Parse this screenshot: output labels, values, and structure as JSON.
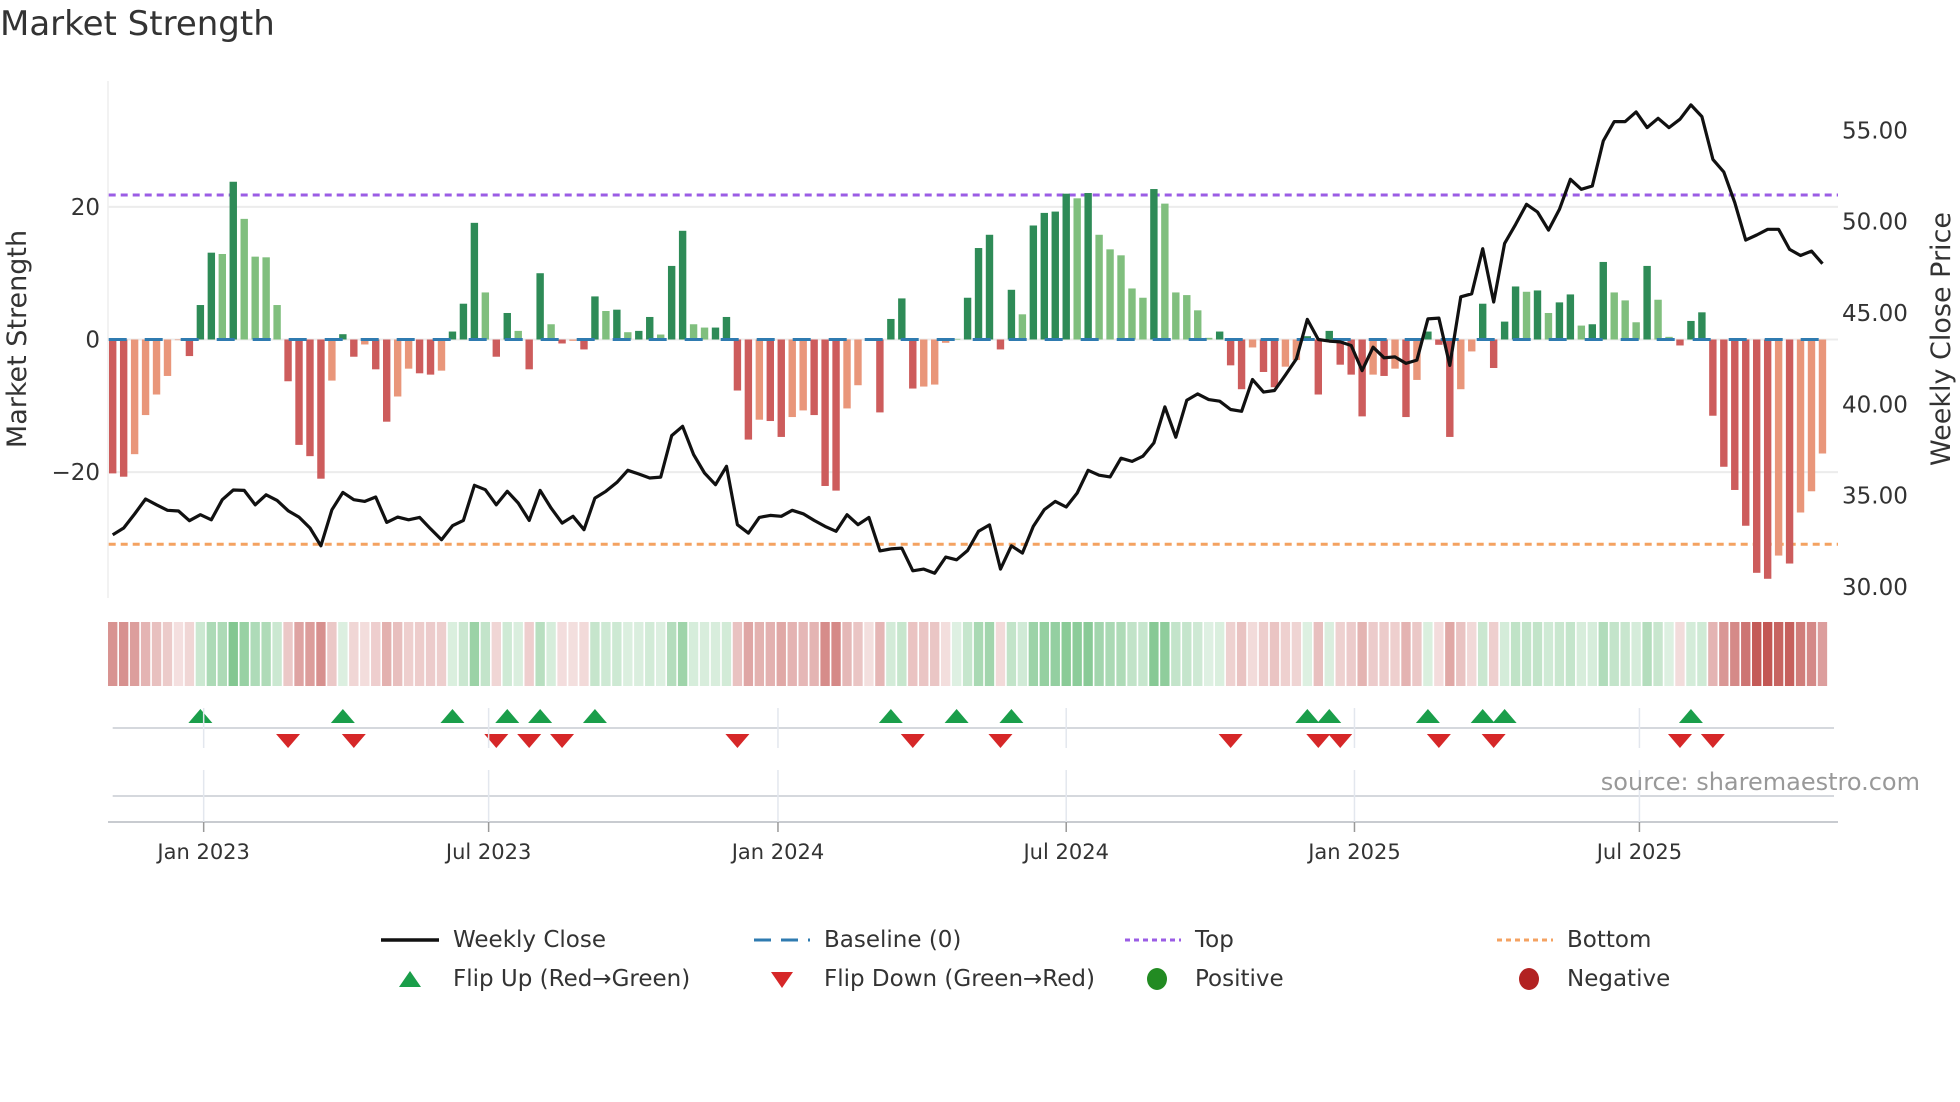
{
  "title": "Market Strength",
  "source": "source: sharemaestro.com",
  "legend": {
    "weekly_close": "Weekly Close",
    "baseline": "Baseline (0)",
    "top": "Top",
    "bottom": "Bottom",
    "flip_up": "Flip Up (Red→Green)",
    "flip_down": "Flip Down (Green→Red)",
    "positive": "Positive",
    "negative": "Negative"
  },
  "colors": {
    "pos_strong": "#2e8b57",
    "pos_weak": "#80bf7e",
    "neg_strong": "#cd5c5c",
    "neg_weak": "#e9967a",
    "baseline": "#2f7bb0",
    "top": "#9b5de5",
    "bottom": "#f4a261",
    "close": "#111111",
    "flip_up": "#1a9e4a",
    "flip_down": "#d62728",
    "positive": "#228b22",
    "negative": "#b22222",
    "strip_pos": "#4caf61",
    "strip_neg": "#c0504d"
  },
  "chart_data": {
    "type": "bar",
    "title": "Market Strength",
    "ylabel": "Market Strength",
    "y2label": "Weekly Close Price",
    "ylim": [
      -39,
      39
    ],
    "y2lim": [
      29.4,
      57.7
    ],
    "yticks": [
      {
        "value": 20,
        "label": "20"
      },
      {
        "value": 0,
        "label": "0"
      },
      {
        "value": -20,
        "label": "−20"
      }
    ],
    "y2ticks": [
      {
        "value": 55,
        "label": "55.00"
      },
      {
        "value": 50,
        "label": "50.00"
      },
      {
        "value": 45,
        "label": "45.00"
      },
      {
        "value": 40,
        "label": "40.00"
      },
      {
        "value": 35,
        "label": "35.00"
      },
      {
        "value": 30,
        "label": "30.00"
      }
    ],
    "xticks": [
      {
        "week": 8.3,
        "label": "Jan 2023"
      },
      {
        "week": 34.3,
        "label": "Jul 2023"
      },
      {
        "week": 60.7,
        "label": "Jan 2024"
      },
      {
        "week": 87.0,
        "label": "Jul 2024"
      },
      {
        "week": 113.3,
        "label": "Jan 2025"
      },
      {
        "week": 139.3,
        "label": "Jul 2025"
      }
    ],
    "top_level": 21.8,
    "bottom_level": -30.9,
    "strength": [
      -20.2,
      -20.7,
      -17.3,
      -11.4,
      -8.3,
      -5.5,
      -0.1,
      -2.5,
      5.2,
      13.1,
      12.9,
      23.8,
      18.2,
      12.5,
      12.4,
      5.2,
      -6.3,
      -15.9,
      -17.6,
      -21.0,
      -6.2,
      0.8,
      -2.6,
      -0.75,
      -4.5,
      -12.4,
      -8.6,
      -4.4,
      -5.1,
      -5.3,
      -4.7,
      1.2,
      5.4,
      17.6,
      7.1,
      -2.6,
      4.0,
      1.3,
      -4.5,
      10.0,
      2.3,
      -0.6,
      -0.2,
      -1.5,
      6.5,
      4.3,
      4.5,
      1.1,
      1.3,
      3.4,
      0.75,
      11.1,
      16.4,
      2.3,
      1.8,
      1.8,
      3.4,
      -7.7,
      -15.1,
      -12.1,
      -12.3,
      -14.7,
      -11.7,
      -10.7,
      -11.4,
      -22.1,
      -22.8,
      -10.4,
      -6.9,
      -0.2,
      -11.0,
      3.1,
      6.2,
      -7.4,
      -7.1,
      -6.8,
      -0.5,
      0.1,
      6.3,
      13.8,
      15.8,
      -1.5,
      7.5,
      3.8,
      17.2,
      19.1,
      19.3,
      22.0,
      21.3,
      22.1,
      15.8,
      13.6,
      12.7,
      7.7,
      6.3,
      22.7,
      20.5,
      7.1,
      6.7,
      4.4,
      0.25,
      1.2,
      -3.9,
      -7.5,
      -1.2,
      -4.9,
      -7.2,
      -4.1,
      -3.1,
      0.5,
      -8.3,
      1.3,
      -3.8,
      -5.3,
      -11.6,
      -5.3,
      -5.5,
      -4.4,
      -11.7,
      -6.1,
      1.2,
      -0.8,
      -14.7,
      -7.5,
      -1.8,
      5.4,
      -4.3,
      2.7,
      8.0,
      7.2,
      7.4,
      4.0,
      5.6,
      6.8,
      2.1,
      2.3,
      11.7,
      7.1,
      5.9,
      2.6,
      11.1,
      6.0,
      0.4,
      -0.9,
      2.8,
      4.1,
      -11.5,
      -19.2,
      -22.7,
      -28.1,
      -35.2,
      -36.1,
      -32.6,
      -33.8,
      -26.1,
      -22.9,
      -17.2
    ],
    "strong": [
      1,
      1,
      0,
      0,
      0,
      0,
      0,
      1,
      1,
      1,
      0,
      1,
      0,
      0,
      0,
      0,
      1,
      1,
      1,
      1,
      0,
      1,
      1,
      0,
      1,
      1,
      0,
      0,
      1,
      1,
      0,
      1,
      1,
      1,
      0,
      1,
      1,
      0,
      1,
      1,
      0,
      1,
      0,
      1,
      1,
      0,
      1,
      0,
      1,
      1,
      0,
      1,
      1,
      0,
      0,
      1,
      1,
      1,
      1,
      0,
      1,
      1,
      0,
      0,
      1,
      1,
      1,
      0,
      0,
      0,
      1,
      1,
      1,
      1,
      0,
      0,
      0,
      0,
      1,
      1,
      1,
      1,
      1,
      0,
      1,
      1,
      1,
      1,
      0,
      1,
      0,
      0,
      0,
      0,
      0,
      1,
      0,
      0,
      0,
      0,
      0,
      1,
      1,
      1,
      0,
      1,
      1,
      0,
      0,
      1,
      1,
      1,
      1,
      1,
      1,
      0,
      1,
      0,
      1,
      0,
      1,
      1,
      1,
      0,
      0,
      1,
      1,
      1,
      1,
      0,
      1,
      0,
      1,
      1,
      0,
      1,
      1,
      0,
      0,
      0,
      1,
      0,
      0,
      1,
      1,
      1,
      1,
      1,
      1,
      1,
      1,
      1,
      0,
      1,
      0,
      0,
      0
    ],
    "close": [
      32.86,
      33.23,
      34.0,
      34.82,
      34.5,
      34.2,
      34.16,
      33.63,
      33.96,
      33.68,
      34.78,
      35.31,
      35.29,
      34.5,
      35.05,
      34.74,
      34.18,
      33.83,
      33.23,
      32.26,
      34.23,
      35.18,
      34.78,
      34.69,
      34.93,
      33.54,
      33.83,
      33.68,
      33.81,
      33.19,
      32.59,
      33.36,
      33.65,
      35.57,
      35.33,
      34.5,
      35.24,
      34.6,
      33.65,
      35.29,
      34.32,
      33.5,
      33.87,
      33.14,
      34.87,
      35.24,
      35.73,
      36.39,
      36.19,
      35.97,
      36.02,
      38.29,
      38.8,
      37.25,
      36.24,
      35.6,
      36.61,
      33.41,
      32.95,
      33.81,
      33.92,
      33.87,
      34.2,
      34.01,
      33.65,
      33.32,
      33.05,
      33.96,
      33.41,
      33.81,
      31.98,
      32.09,
      32.13,
      30.89,
      30.98,
      30.76,
      31.64,
      31.49,
      32.0,
      33.05,
      33.4,
      30.98,
      32.26,
      31.86,
      33.32,
      34.24,
      34.69,
      34.38,
      35.15,
      36.39,
      36.12,
      36.03,
      37.05,
      36.88,
      37.16,
      37.89,
      39.86,
      38.2,
      40.23,
      40.57,
      40.26,
      40.17,
      39.72,
      39.62,
      41.36,
      40.67,
      40.76,
      41.6,
      42.49,
      44.65,
      43.55,
      43.46,
      43.42,
      43.22,
      41.85,
      43.13,
      42.55,
      42.6,
      42.24,
      42.42,
      44.68,
      44.72,
      42.13,
      45.89,
      46.05,
      48.52,
      45.6,
      48.81,
      49.85,
      50.95,
      50.53,
      49.54,
      50.67,
      52.32,
      51.77,
      51.95,
      54.42,
      55.48,
      55.48,
      56.01,
      55.15,
      55.66,
      55.15,
      55.61,
      56.39,
      55.75,
      53.41,
      52.72,
      51.04,
      48.99,
      49.27,
      49.58,
      49.58,
      48.48,
      48.15,
      48.39,
      47.7
    ],
    "flip_up_weeks": [
      8,
      21,
      31,
      36,
      39,
      44,
      71,
      77,
      82,
      109,
      111,
      120,
      125,
      127,
      144
    ],
    "flip_down_weeks": [
      16,
      22,
      35,
      38,
      41,
      57,
      73,
      81,
      102,
      110,
      112,
      121,
      126,
      143,
      146
    ]
  }
}
